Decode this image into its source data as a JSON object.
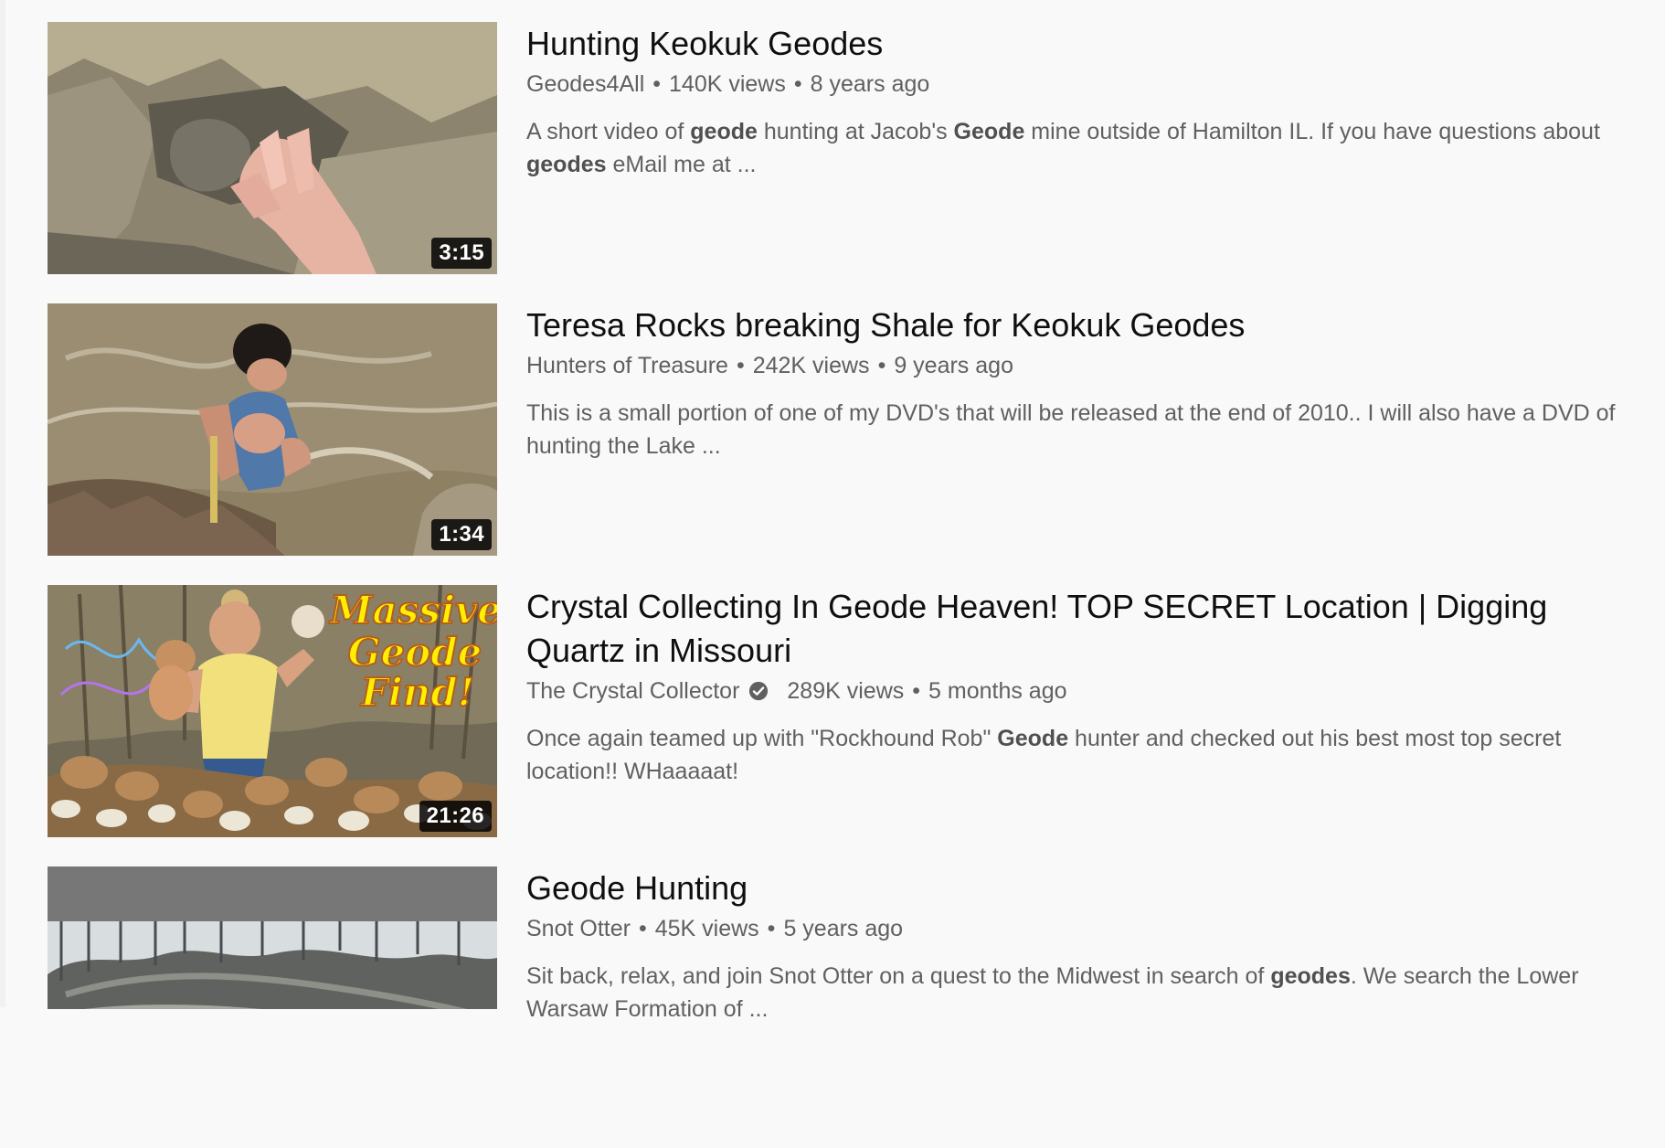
{
  "results": [
    {
      "title": "Hunting Keokuk Geodes",
      "channel": "Geodes4All",
      "views": "140K views",
      "age": "8 years ago",
      "duration": "3:15",
      "verified": false,
      "description": [
        {
          "text": "A short video of "
        },
        {
          "text": "geode",
          "bold": true
        },
        {
          "text": " hunting at Jacob's "
        },
        {
          "text": "Geode",
          "bold": true
        },
        {
          "text": " mine outside of Hamilton IL. If you have questions about "
        },
        {
          "text": "geodes",
          "bold": true
        },
        {
          "text": " eMail me at ..."
        }
      ]
    },
    {
      "title": "Teresa Rocks breaking Shale for Keokuk Geodes",
      "channel": "Hunters of Treasure",
      "views": "242K views",
      "age": "9 years ago",
      "duration": "1:34",
      "verified": false,
      "description": [
        {
          "text": "This is a small portion of one of my DVD's that will be released at the end of 2010.. I will also have a DVD of hunting the Lake ..."
        }
      ]
    },
    {
      "title": "Crystal Collecting In Geode Heaven! TOP SECRET Location | Digging Quartz in Missouri",
      "channel": "The Crystal Collector",
      "views": "289K views",
      "age": "5 months ago",
      "duration": "21:26",
      "verified": true,
      "thumbnail_text": [
        "Massive",
        "Geode",
        "Find!"
      ],
      "description": [
        {
          "text": "Once again teamed up with \"Rockhound Rob\" "
        },
        {
          "text": "Geode",
          "bold": true
        },
        {
          "text": " hunter and checked out his best most top secret location!! WHaaaaat!"
        }
      ]
    },
    {
      "title": "Geode Hunting",
      "channel": "Snot Otter",
      "views": "45K views",
      "age": "5 years ago",
      "duration": "",
      "verified": false,
      "description": [
        {
          "text": "Sit back, relax, and join Snot Otter on a quest to the Midwest in search of "
        },
        {
          "text": "geodes",
          "bold": true
        },
        {
          "text": ". We search the Lower Warsaw Formation of ..."
        }
      ]
    }
  ],
  "colors": {
    "background": "#f9f9f9",
    "title": "#0f0f0f",
    "secondary": "#606060",
    "duration_bg": "#000000"
  }
}
